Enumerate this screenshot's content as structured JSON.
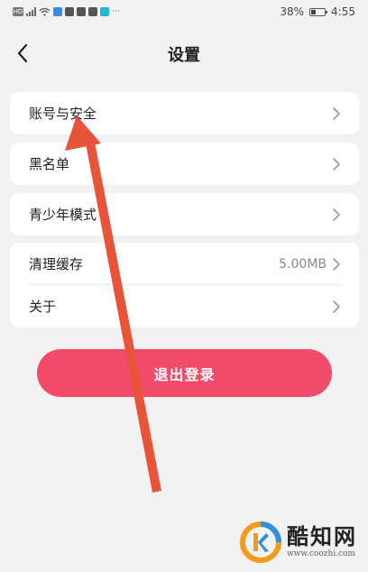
{
  "status_bar": {
    "battery_text": "38%",
    "battery_level": 0.38,
    "time": "4:55",
    "more_indicator": "···",
    "icons": [
      "hd-icon",
      "signal-icon",
      "wifi-icon",
      "p-app-icon",
      "app-icon-1",
      "mail-icon",
      "shield-app-icon",
      "q-app-icon"
    ]
  },
  "nav": {
    "title": "设置",
    "back_icon": "chevron-left-icon"
  },
  "settings": {
    "account_security": "账号与安全",
    "blacklist": "黑名单",
    "teen_mode": "青少年模式",
    "clear_cache": "清理缓存",
    "cache_size": "5.00MB",
    "about": "关于"
  },
  "logout": {
    "label": "退出登录"
  },
  "colors": {
    "background": "#f2f2f2",
    "logout_button": "#f24a6a",
    "annotation_arrow": "#e8543a",
    "watermark_orange": "#f39a1e",
    "watermark_blue": "#2f8fe0"
  },
  "watermark": {
    "name": "酷知网",
    "url": "www.coozhi.com"
  }
}
